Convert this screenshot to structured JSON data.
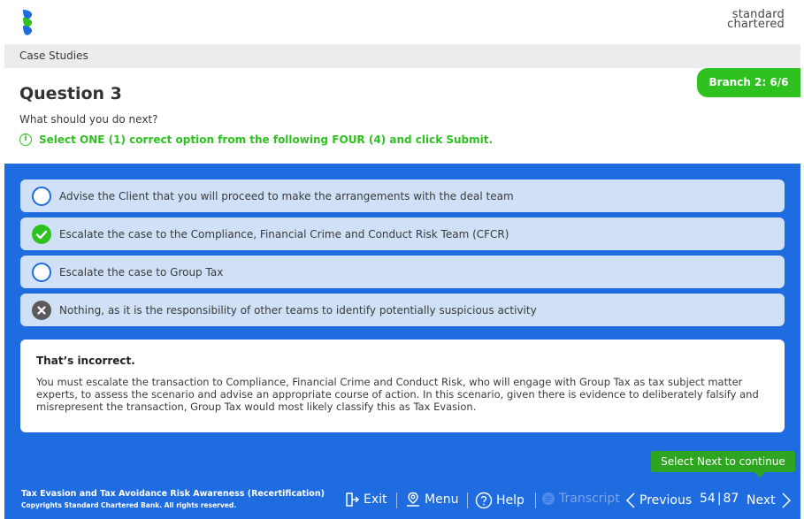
{
  "brand": {
    "line1": "standard",
    "line2": "chartered"
  },
  "breadcrumb": "Case Studies",
  "branch_tag": "Branch 2: 6/6",
  "question": {
    "title": "Question 3",
    "prompt": "What should you do next?",
    "instruction": "Select ONE (1) correct option from the following FOUR (4) and click Submit."
  },
  "options": [
    {
      "text": "Advise the Client that you will proceed to make the arrangements with the deal team",
      "state": "unselected"
    },
    {
      "text": "Escalate the case to the Compliance, Financial Crime and Conduct Risk Team (CFCR)",
      "state": "correct"
    },
    {
      "text": "Escalate the case to Group Tax",
      "state": "unselected"
    },
    {
      "text": "Nothing, as it is the responsibility of other teams to identify potentially suspicious activity",
      "state": "incorrect"
    }
  ],
  "feedback": {
    "title": "That’s incorrect.",
    "body": "You must escalate the transaction to Compliance, Financial Crime and Conduct Risk, who will engage with Group Tax as tax subject matter experts, to assess the scenario and advise an appropriate course of action. In this scenario, given there is evidence to deliberately falsify and misrepresent the transaction, Group Tax would most likely classify this as Tax Evasion."
  },
  "tooltip": "Select Next to continue",
  "footer": {
    "course_title": "Tax Evasion and Tax Avoidance Risk Awareness (Recertification)",
    "copyright": "Copyrights Standard Chartered Bank. All rights reserved.",
    "exit": "Exit",
    "menu": "Menu",
    "help": "Help",
    "transcript": "Transcript",
    "previous": "Previous",
    "page_current": "54",
    "page_total": "87",
    "next": "Next"
  },
  "colors": {
    "primary_blue": "#1f6be0",
    "green": "#2ec120",
    "option_bg": "#cfe0f7"
  }
}
